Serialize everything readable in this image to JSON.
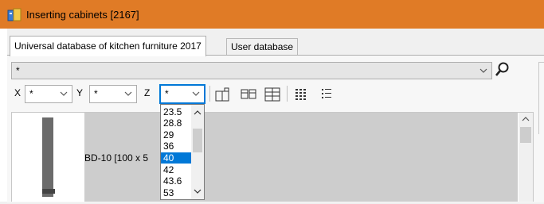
{
  "window": {
    "title": "Inserting cabinets [2167]",
    "icon": "cabinet-app-icon"
  },
  "tabs": [
    {
      "label": "Universal database of kitchen furniture 2017",
      "active": true
    },
    {
      "label": "User database",
      "active": false
    }
  ],
  "filter": {
    "category_value": "*"
  },
  "dims": {
    "x_label": "X",
    "x_value": "*",
    "y_label": "Y",
    "y_value": "*",
    "z_label": "Z",
    "z_value": "*"
  },
  "toolbar_icons": [
    "cabinet-view-icon",
    "panel-view-icon",
    "grid-view-icon",
    "tiles-view-icon",
    "list-view-icon"
  ],
  "z_dropdown": {
    "options": [
      "23.5",
      "28.8",
      "29",
      "36",
      "40",
      "42",
      "43.6",
      "53"
    ],
    "selected": "40"
  },
  "items": [
    {
      "label": "BD-10  [100 x 5"
    }
  ],
  "colors": {
    "titlebar": "#e07b26",
    "selection": "#0078d7"
  }
}
